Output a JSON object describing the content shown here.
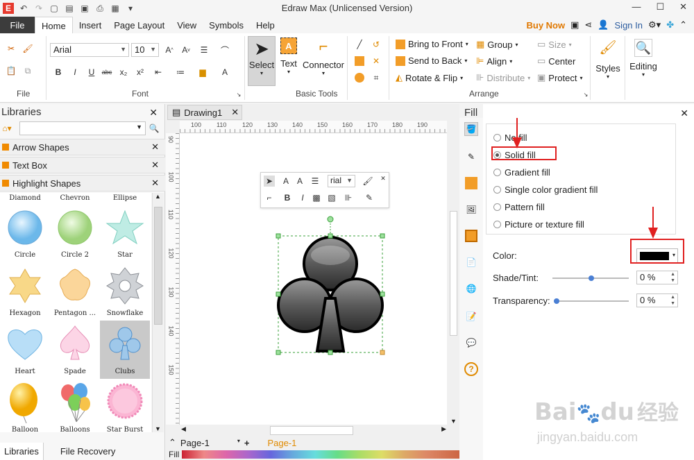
{
  "window": {
    "title": "Edraw Max (Unlicensed Version)"
  },
  "menu": {
    "file_label": "File",
    "tabs": [
      "Home",
      "Insert",
      "Page Layout",
      "View",
      "Symbols",
      "Help"
    ],
    "active_tab": "Home",
    "buy_now": "Buy Now",
    "sign_in": "Sign In"
  },
  "ribbon": {
    "file_group_label": "File",
    "font_group_label": "Font",
    "basic_tools_label": "Basic Tools",
    "arrange_label": "Arrange",
    "font_family": "Arial",
    "font_size": "10",
    "tools": {
      "select": "Select",
      "text": "Text",
      "connector": "Connector"
    },
    "arrange": {
      "bring_to_front": "Bring to Front",
      "send_to_back": "Send to Back",
      "rotate_flip": "Rotate & Flip",
      "group": "Group",
      "align": "Align",
      "distribute": "Distribute",
      "size": "Size",
      "center": "Center",
      "protect": "Protect"
    },
    "styles_label": "Styles",
    "editing_label": "Editing"
  },
  "libraries": {
    "title": "Libraries",
    "categories": [
      "Arrow Shapes",
      "Text Box",
      "Highlight Shapes"
    ],
    "shapes": [
      {
        "name": "Diamond"
      },
      {
        "name": "Chevron"
      },
      {
        "name": "Ellipse"
      },
      {
        "name": "Circle"
      },
      {
        "name": "Circle 2"
      },
      {
        "name": "Star"
      },
      {
        "name": "Hexagon"
      },
      {
        "name": "Pentagon ..."
      },
      {
        "name": "Snowflake"
      },
      {
        "name": "Heart"
      },
      {
        "name": "Spade"
      },
      {
        "name": "Clubs"
      },
      {
        "name": "Balloon"
      },
      {
        "name": "Balloons"
      },
      {
        "name": "Star Burst"
      }
    ],
    "tabs": [
      "Libraries",
      "File Recovery"
    ]
  },
  "document": {
    "tab_name": "Drawing1",
    "ruler_h": [
      "100",
      "110",
      "120",
      "130",
      "140",
      "150",
      "160",
      "170",
      "180",
      "190"
    ],
    "ruler_v": [
      "90",
      "100",
      "110",
      "120",
      "130",
      "140",
      "150"
    ],
    "page_select": "Page-1",
    "page_tab": "Page-1",
    "fill_label": "Fill",
    "mini_font": "rial"
  },
  "fill_panel": {
    "title": "Fill",
    "options": [
      "No fill",
      "Solid fill",
      "Gradient fill",
      "Single color gradient fill",
      "Pattern fill",
      "Picture or texture fill"
    ],
    "selected_option": "Solid fill",
    "color_label": "Color:",
    "color_value": "#000000",
    "shade_label": "Shade/Tint:",
    "shade_value": "0 %",
    "transparency_label": "Transparency:",
    "transparency_value": "0 %"
  },
  "watermark": {
    "brand": "Bai",
    "brand2": "du",
    "cn": "经验",
    "url": "jingyan.baidu.com"
  },
  "colors": {
    "accent_orange": "#f08a00",
    "annotation_red": "#e02020",
    "dark_tab": "#3c3c3c"
  }
}
